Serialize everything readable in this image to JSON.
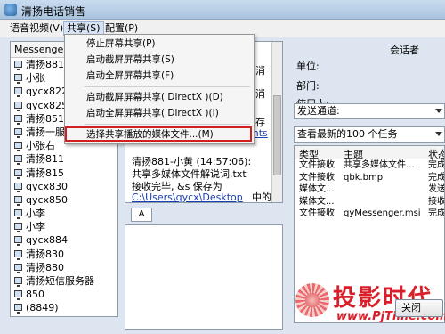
{
  "window": {
    "title": "清扬电话销售"
  },
  "menubar": {
    "items": [
      {
        "label": "语音视频(V)"
      },
      {
        "label": "共享(S)"
      },
      {
        "label": "配置(P)"
      }
    ]
  },
  "share_menu": {
    "items": [
      {
        "label": "停止屏幕共享(P)"
      },
      {
        "label": "启动截屏屏幕共享(S)"
      },
      {
        "label": "启动全屏屏幕共享(F)"
      },
      {
        "label": "启动截屏屏幕共享( DirectX )(D)"
      },
      {
        "label": "启动全屏屏幕共享( DirectX )(I)"
      },
      {
        "label": "选择共享播放的媒体文件...(M)"
      }
    ]
  },
  "contacts": {
    "header": "Messenger",
    "items": [
      "清扬881",
      "小张",
      "qycx822",
      "qycx825",
      "清扬851",
      "清扬一服",
      "小张右",
      "清扬811",
      "清扬815",
      "qycx830",
      "qycx850",
      "小李",
      "小李",
      "qycx884",
      "清扬830",
      "清扬880",
      "清扬短信服务器",
      "850",
      "(8849)"
    ]
  },
  "chat": {
    "fragments": {
      "a": "消",
      "b": "消",
      "c": "存",
      "d": "ents",
      "e": "中的"
    },
    "lines": {
      "header": "清扬881-小黄  (14:57:06):",
      "msg1": "共享多媒体文件解说词.txt",
      "msg2": "接收完毕, &s 保存为",
      "path": "C:\\Users\\qycx\\Desktop"
    },
    "tab_label": "A"
  },
  "right_panel": {
    "title": "会话者",
    "labels": {
      "unit": "单位:",
      "dept": "部门:",
      "user": "使用人:"
    },
    "send_channel": "发送通道:",
    "task_filter": "查看最新的100 个任务",
    "table": {
      "headers": [
        "类型",
        "主题",
        "状态"
      ],
      "rows": [
        [
          "文件接收",
          "共享多媒体文件...",
          "完成"
        ],
        [
          "文件接收",
          "qbk.bmp",
          "完成"
        ],
        [
          "媒体文...",
          "",
          "发送"
        ],
        [
          "媒体文...",
          "",
          "接收"
        ],
        [
          "文件接收",
          "qyMessenger.msi",
          "完成"
        ]
      ]
    },
    "close_button": "关闭"
  },
  "watermark": {
    "text": "投影时代",
    "url": "www.PjTime.com"
  }
}
